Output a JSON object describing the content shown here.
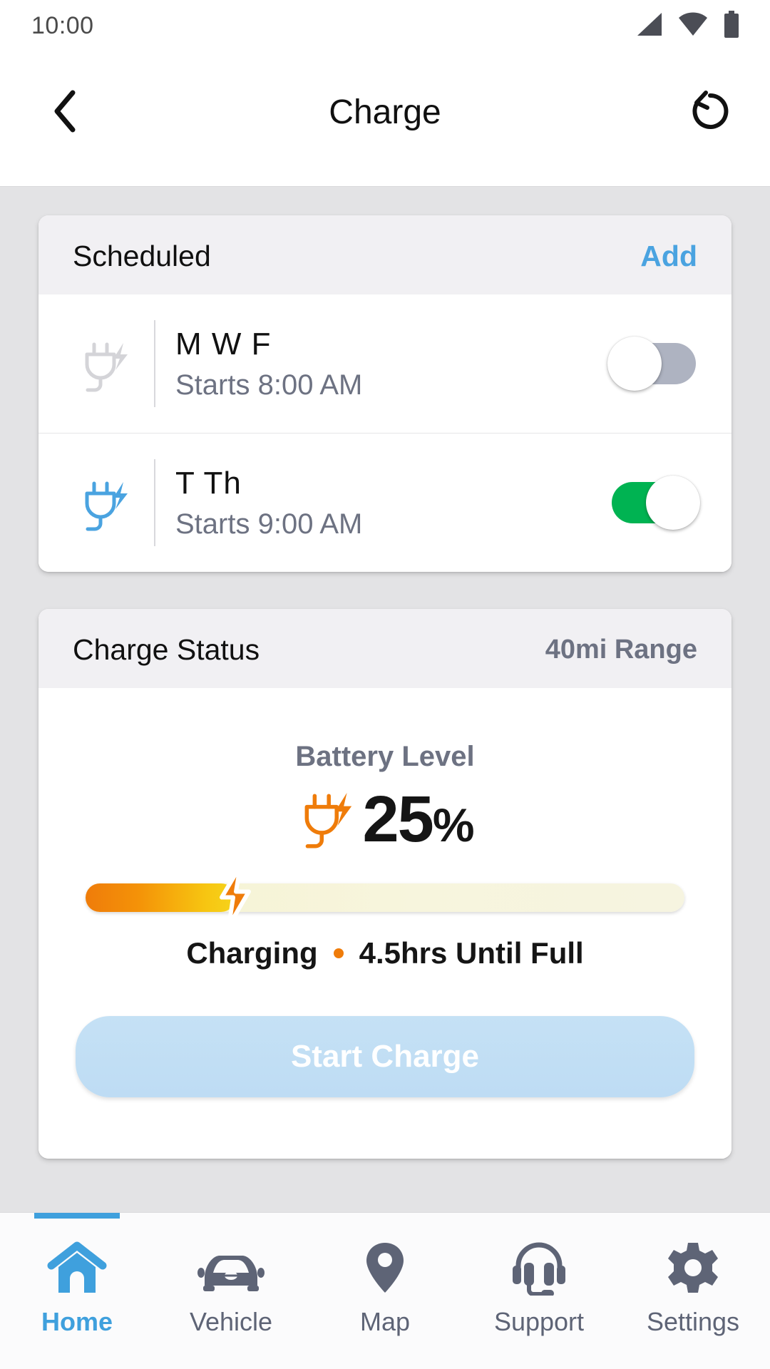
{
  "status_bar": {
    "time": "10:00",
    "icons": [
      "signal-icon",
      "wifi-icon",
      "battery-icon"
    ]
  },
  "app_bar": {
    "back_icon": "chevron-left-icon",
    "title": "Charge",
    "refresh_icon": "refresh-icon"
  },
  "scheduled_card": {
    "title": "Scheduled",
    "add_label": "Add",
    "rows": [
      {
        "icon": "plug-charge-icon",
        "icon_color": "#d4d4d8",
        "days": "M W F",
        "time": "Starts 8:00 AM",
        "toggle_state": "off"
      },
      {
        "icon": "plug-charge-icon",
        "icon_color": "#4aa3e0",
        "days": "T Th",
        "time": "Starts 9:00 AM",
        "toggle_state": "on"
      }
    ]
  },
  "charge_status_card": {
    "title": "Charge Status",
    "range": "40mi Range",
    "battery_label": "Battery Level",
    "battery_icon": "plug-charge-icon",
    "battery_percent_value": "25",
    "battery_percent_unit": "%",
    "battery_percent_number": 25,
    "progress_bolt_icon": "lightning-bolt-icon",
    "charging_state": "Charging",
    "separator_icon": "orange-dot",
    "time_until_full": "4.5hrs Until Full",
    "cta_label": "Start Charge"
  },
  "bottom_nav": {
    "active_index": 0,
    "items": [
      {
        "label": "Home",
        "icon": "home-icon"
      },
      {
        "label": "Vehicle",
        "icon": "car-icon"
      },
      {
        "label": "Map",
        "icon": "map-pin-icon"
      },
      {
        "label": "Support",
        "icon": "headset-icon"
      },
      {
        "label": "Settings",
        "icon": "gear-icon"
      }
    ]
  },
  "colors": {
    "accent_blue": "#3fa0dd",
    "toggle_on_green": "#00b352",
    "toggle_off_gray": "#aeb3c1",
    "charge_orange": "#ef7c0a",
    "page_background": "#e3e3e5",
    "card_header": "#f1f0f3",
    "muted_text": "#6d7282"
  }
}
